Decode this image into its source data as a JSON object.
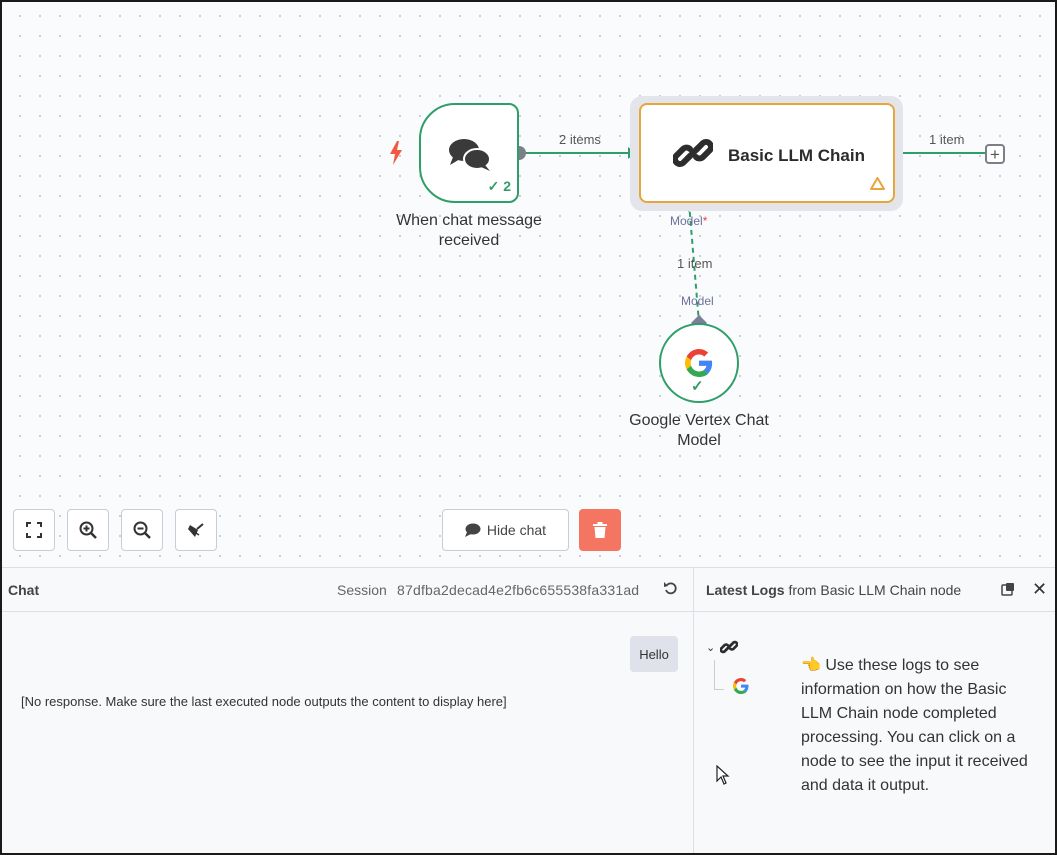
{
  "canvas": {
    "nodes": {
      "trigger": {
        "label_line1": "When chat message",
        "label_line2": "received",
        "exec_count": "2",
        "icon": "chat-bubbles-icon"
      },
      "llm_chain": {
        "label": "Basic LLM Chain",
        "icon": "link-chain-icon",
        "warning_icon": "warning-triangle-icon"
      },
      "vertex": {
        "label_line1": "Google Vertex Chat",
        "label_line2": "Model",
        "icon": "google-icon"
      }
    },
    "edges": {
      "trigger_to_chain": "2 items",
      "chain_out": "1 item",
      "model_link": "1 item"
    },
    "ports": {
      "model_top": "Model",
      "model_required": "*",
      "model_bottom": "Model"
    },
    "controls": {
      "hide_chat": "Hide chat"
    }
  },
  "chat": {
    "title": "Chat",
    "session_label": "Session",
    "session_id": "87dfba2decad4e2fb6c655538fa331ad",
    "messages": {
      "user": "Hello",
      "bot": "[No response. Make sure the last executed node outputs the content to display here]"
    }
  },
  "logs": {
    "title_bold": "Latest Logs",
    "title_rest": " from Basic LLM Chain node",
    "hint_emoji": "👈",
    "hint": "Use these logs to see information on how the Basic LLM Chain node completed processing. You can click on a node to see the input it received and data it output."
  },
  "colors": {
    "success": "#2f9e6a",
    "warning": "#e7a63b",
    "danger": "#f47562",
    "trigger": "#f05a42"
  }
}
